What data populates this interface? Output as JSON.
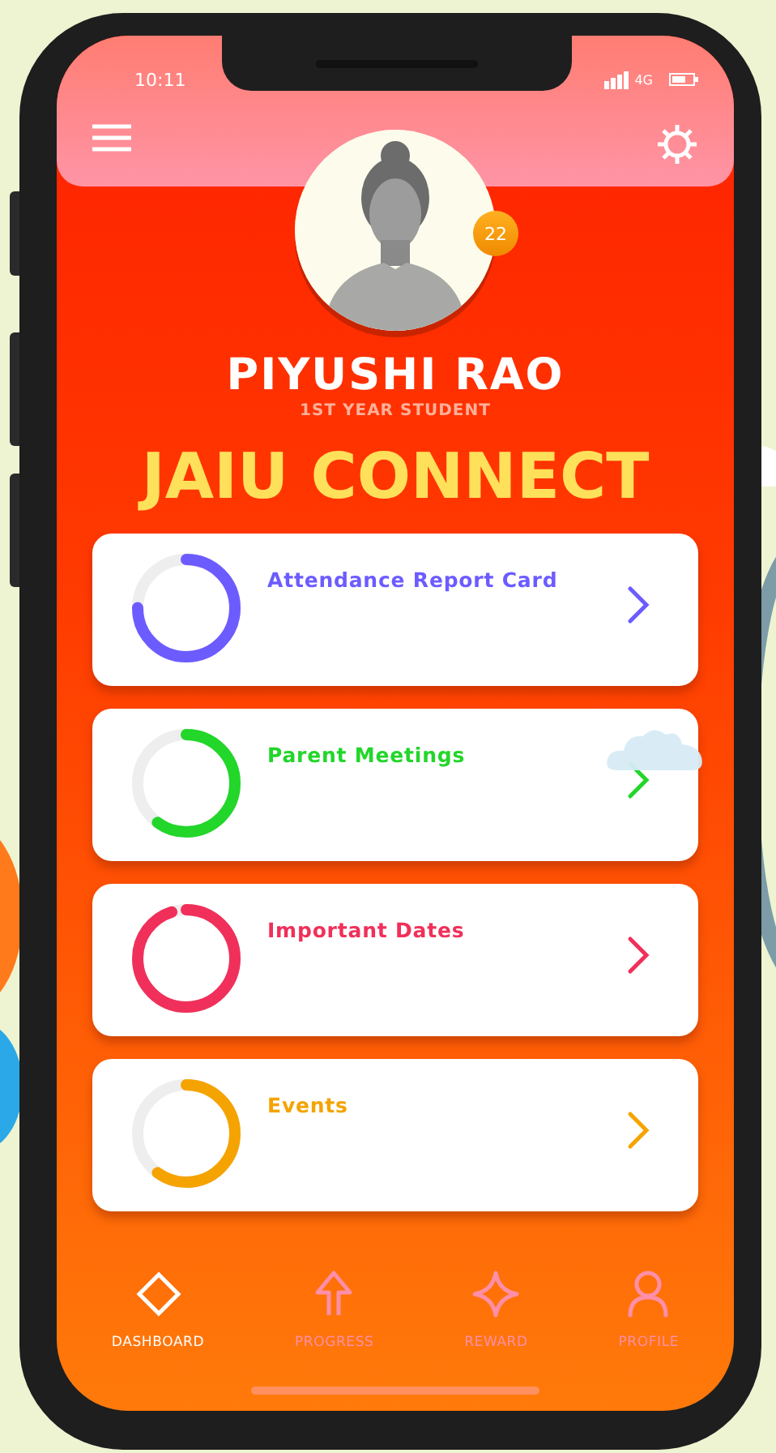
{
  "status_bar": {
    "time": "10:11",
    "network": "4G"
  },
  "profile": {
    "name": "PIYUSHI RAO",
    "subtitle": "1ST YEAR STUDENT",
    "badge": "22"
  },
  "app_title": "JAIU CONNECT",
  "cards": [
    {
      "title": "Attendance Report Card",
      "level": 0.75,
      "color": "#6c5cff"
    },
    {
      "title": "Parent Meetings",
      "level": 0.6,
      "color": "#22d62a"
    },
    {
      "title": "Important Dates",
      "level": 0.95,
      "color": "#f0305a"
    },
    {
      "title": "Events",
      "level": 0.6,
      "color": "#f5a300"
    }
  ],
  "nav": [
    {
      "label": "DASHBOARD",
      "kind": "diamond",
      "selected": true
    },
    {
      "label": "PROGRESS",
      "kind": "arrow",
      "selected": false
    },
    {
      "label": "REWARD",
      "kind": "star",
      "selected": false
    },
    {
      "label": "PROFILE",
      "kind": "person",
      "selected": false
    }
  ]
}
